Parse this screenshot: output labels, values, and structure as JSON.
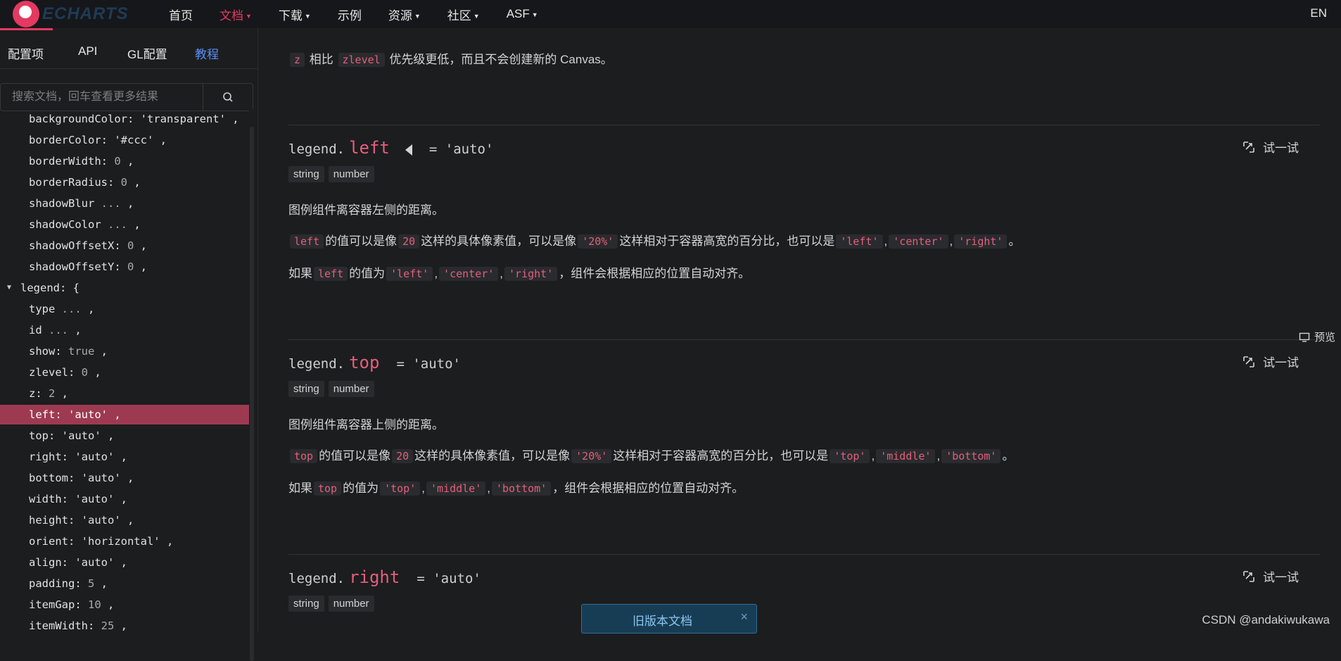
{
  "topbar": {
    "logo_text": "ECHARTS",
    "nav": [
      {
        "label": "首页",
        "dropdown": false,
        "active": false
      },
      {
        "label": "文档",
        "dropdown": true,
        "active": true
      },
      {
        "label": "下载",
        "dropdown": true,
        "active": false
      },
      {
        "label": "示例",
        "dropdown": false,
        "active": false
      },
      {
        "label": "资源",
        "dropdown": true,
        "active": false
      },
      {
        "label": "社区",
        "dropdown": true,
        "active": false
      },
      {
        "label": "ASF",
        "dropdown": true,
        "active": false
      }
    ],
    "lang": "EN"
  },
  "sidebar": {
    "tabs": [
      "配置项",
      "API",
      "GL配置",
      "教程"
    ],
    "search_placeholder": "搜索文档，回车查看更多结果",
    "tree": [
      {
        "key": "backgroundColor: ",
        "val": "'transparent'",
        "suffix": " ,"
      },
      {
        "key": "borderColor: ",
        "val": "'#ccc'",
        "suffix": " ,"
      },
      {
        "key": "borderWidth: ",
        "val": "0",
        "suffix": " ,"
      },
      {
        "key": "borderRadius: ",
        "val": "0",
        "suffix": " ,"
      },
      {
        "key": "shadowBlur ",
        "val": "...",
        "suffix": " ,"
      },
      {
        "key": "shadowColor ",
        "val": "...",
        "suffix": " ,"
      },
      {
        "key": "shadowOffsetX: ",
        "val": "0",
        "suffix": " ,"
      },
      {
        "key": "shadowOffsetY: ",
        "val": "0",
        "suffix": " ,"
      },
      {
        "key": "legend: {",
        "val": "",
        "suffix": "",
        "top": true
      },
      {
        "key": "type ",
        "val": "...",
        "suffix": " ,"
      },
      {
        "key": "id ",
        "val": "...",
        "suffix": " ,"
      },
      {
        "key": "show: ",
        "val": "true",
        "suffix": " ,"
      },
      {
        "key": "zlevel: ",
        "val": "0",
        "suffix": " ,"
      },
      {
        "key": "z: ",
        "val": "2",
        "suffix": " ,"
      },
      {
        "key": "left: ",
        "val": "'auto'",
        "suffix": " ,",
        "selected": true
      },
      {
        "key": "top: ",
        "val": "'auto'",
        "suffix": " ,"
      },
      {
        "key": "right: ",
        "val": "'auto'",
        "suffix": " ,"
      },
      {
        "key": "bottom: ",
        "val": "'auto'",
        "suffix": " ,"
      },
      {
        "key": "width: ",
        "val": "'auto'",
        "suffix": " ,"
      },
      {
        "key": "height: ",
        "val": "'auto'",
        "suffix": " ,"
      },
      {
        "key": "orient: ",
        "val": "'horizontal'",
        "suffix": " ,"
      },
      {
        "key": "align: ",
        "val": "'auto'",
        "suffix": " ,"
      },
      {
        "key": "padding: ",
        "val": "5",
        "suffix": " ,"
      },
      {
        "key": "itemGap: ",
        "val": "10",
        "suffix": " ,"
      },
      {
        "key": "itemWidth: ",
        "val": "25",
        "suffix": " ,"
      }
    ]
  },
  "content": {
    "z_line": {
      "code1": "z",
      "text1": "相比",
      "code2": "zlevel",
      "text2": "优先级更低，而且不会创建新的 Canvas。"
    },
    "try_label": "试一试",
    "sections": [
      {
        "prefix": "legend.",
        "name": "left",
        "eq": "= 'auto'",
        "types": [
          "string",
          "number"
        ],
        "desc": "图例组件离容器左侧的距离。",
        "p2": {
          "c1": "left",
          "t1": "的值可以是像",
          "c2": "20",
          "t2": "这样的具体像素值，可以是像",
          "c3": "'20%'",
          "t3": "这样相对于容器高宽的百分比，也可以是",
          "c4": "'left'",
          "c5": "'center'",
          "c6": "'right'",
          "t4": "。"
        },
        "p3": {
          "t1": "如果",
          "c1": "left",
          "t2": "的值为",
          "c2": "'left'",
          "c3": "'center'",
          "c4": "'right'",
          "t3": "，组件会根据相应的位置自动对齐。"
        }
      },
      {
        "prefix": "legend.",
        "name": "top",
        "eq": "= 'auto'",
        "types": [
          "string",
          "number"
        ],
        "desc": "图例组件离容器上侧的距离。",
        "p2": {
          "c1": "top",
          "t1": "的值可以是像",
          "c2": "20",
          "t2": "这样的具体像素值，可以是像",
          "c3": "'20%'",
          "t3": "这样相对于容器高宽的百分比，也可以是",
          "c4": "'top'",
          "c5": "'middle'",
          "c6": "'bottom'",
          "t4": "。"
        },
        "p3": {
          "t1": "如果",
          "c1": "top",
          "t2": "的值为",
          "c2": "'top'",
          "c3": "'middle'",
          "c4": "'bottom'",
          "t3": "，组件会根据相应的位置自动对齐。"
        }
      },
      {
        "prefix": "legend.",
        "name": "right",
        "eq": "= 'auto'",
        "types": [
          "string",
          "number"
        ]
      }
    ]
  },
  "preview_label": "预览",
  "old_docs": {
    "label": "旧版本文档",
    "close": "×"
  },
  "watermark": "CSDN @andakiwukawa",
  "colors": {
    "accent": "#e43961",
    "selected_row": "#9d3a51",
    "code": "#e45f7c",
    "link": "#5b8ff9"
  }
}
